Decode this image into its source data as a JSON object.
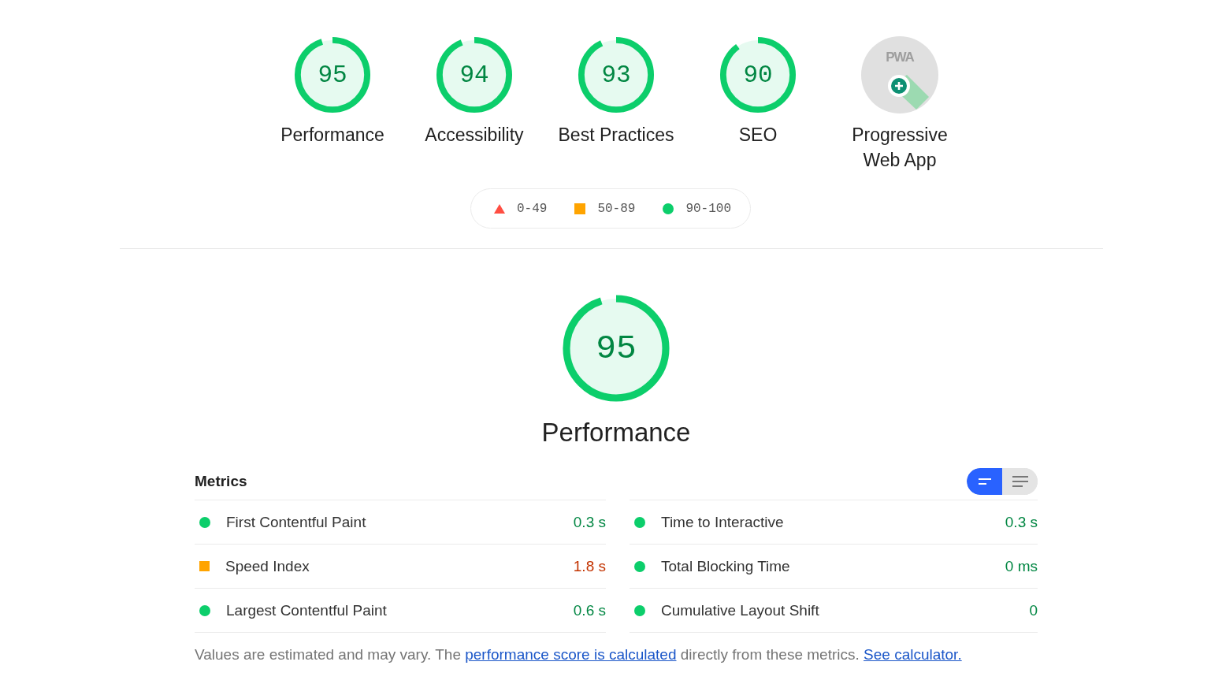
{
  "categories": [
    {
      "kind": "score",
      "score": "95",
      "level": 0.95,
      "label": "Performance"
    },
    {
      "kind": "score",
      "score": "94",
      "level": 0.94,
      "label": "Accessibility"
    },
    {
      "kind": "score",
      "score": "93",
      "level": 0.93,
      "label": "Best Practices"
    },
    {
      "kind": "score",
      "score": "90",
      "level": 0.9,
      "label": "SEO"
    },
    {
      "kind": "pwa",
      "badge_text": "PWA",
      "label": "Progressive Web App"
    }
  ],
  "legend": [
    {
      "kind": "fail",
      "range": "0-49"
    },
    {
      "kind": "average",
      "range": "50-89"
    },
    {
      "kind": "pass",
      "range": "90-100"
    }
  ],
  "main_gauge": {
    "score": "95",
    "level": 0.95,
    "title": "Performance"
  },
  "metrics": {
    "heading": "Metrics",
    "view_toggle": [
      {
        "selected": true
      },
      {
        "selected": false
      }
    ],
    "items": [
      {
        "kind": "pass",
        "name": "First Contentful Paint",
        "value": "0.3 s"
      },
      {
        "kind": "pass",
        "name": "Time to Interactive",
        "value": "0.3 s"
      },
      {
        "kind": "average",
        "name": "Speed Index",
        "value": "1.8 s"
      },
      {
        "kind": "pass",
        "name": "Total Blocking Time",
        "value": "0 ms"
      },
      {
        "kind": "pass",
        "name": "Largest Contentful Paint",
        "value": "0.6 s"
      },
      {
        "kind": "pass",
        "name": "Cumulative Layout Shift",
        "value": "0"
      }
    ]
  },
  "footer": {
    "text_before": "Values are estimated and may vary. The",
    "link_1": "performance score is calculated",
    "text_middle": "directly from these metrics.",
    "link_2": "See calculator."
  }
}
